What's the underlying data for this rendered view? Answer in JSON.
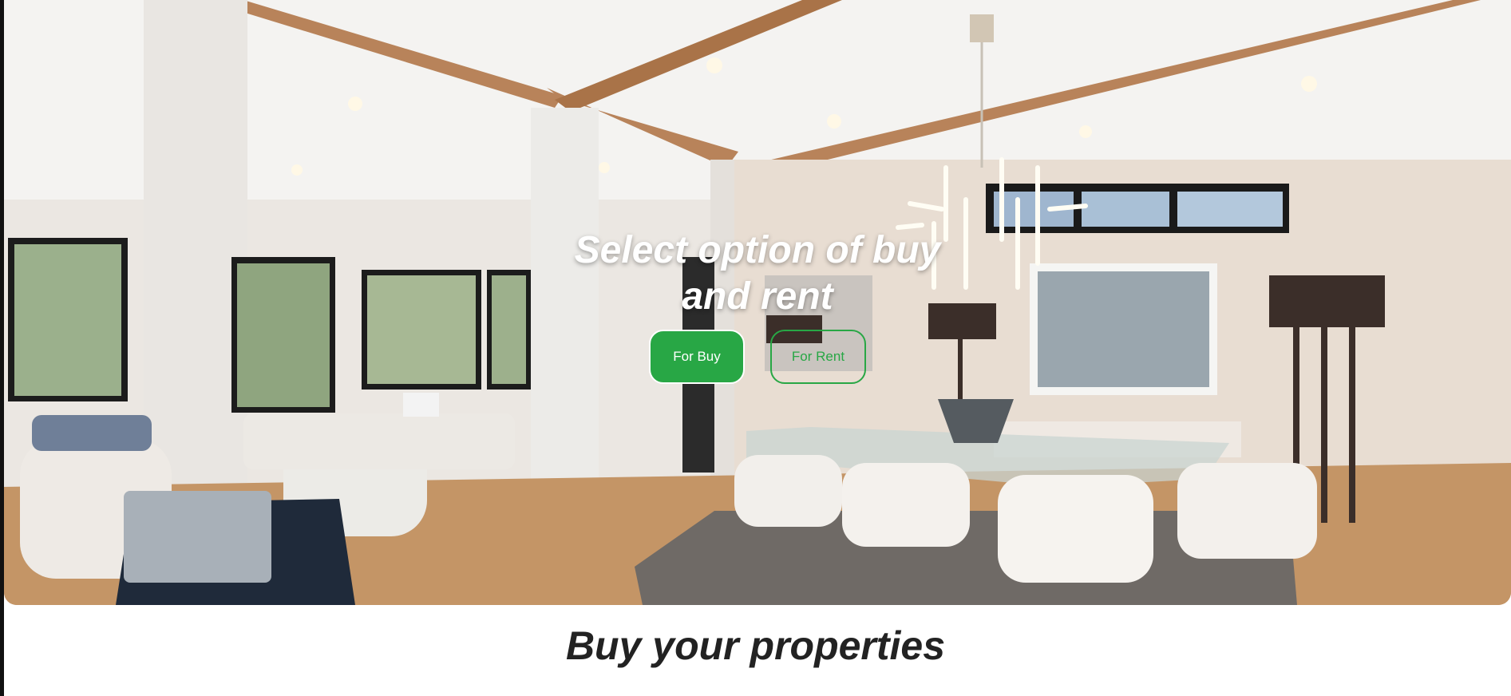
{
  "hero": {
    "image": "modern-interior-dining-room",
    "title": "Select option of buy and rent",
    "buttons": {
      "buy_label": "For Buy",
      "rent_label": "For Rent"
    }
  },
  "section": {
    "title": "Buy your properties"
  },
  "colors": {
    "accent": "#28a745",
    "heading": "#222222",
    "background": "#ffffff"
  }
}
